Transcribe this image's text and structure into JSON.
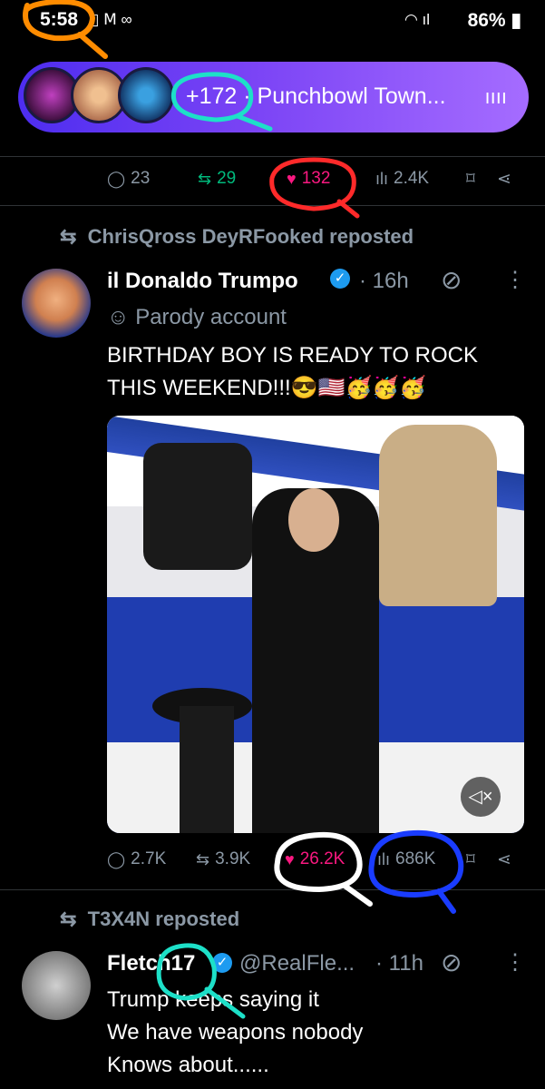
{
  "status_bar": {
    "time": "5:58",
    "battery": "86%"
  },
  "space": {
    "count": "+172 ·",
    "title": "Punchbowl Town..."
  },
  "prev_post": {
    "replies": "23",
    "reposts": "29",
    "likes": "132",
    "views": "2.4K"
  },
  "post1": {
    "reposted_by": "ChrisQross DeyRFooked reposted",
    "name": "il Donaldo Trumpo",
    "time": "· 16h",
    "parody": "Parody account",
    "text_line1": "BIRTHDAY BOY IS READY TO ROCK",
    "text_line2": "THIS WEEKEND!!!😎🇺🇸🥳🥳🥳",
    "replies": "2.7K",
    "reposts": "3.9K",
    "likes": "26.2K",
    "views": "686K"
  },
  "post2": {
    "reposted_by": "T3X4N reposted",
    "name": "Fletch17",
    "handle": "@RealFle...",
    "time": "· 11h",
    "text_line1": "Trump keeps saying it",
    "text_line2": "We have weapons nobody",
    "text_line3": "Knows about......"
  },
  "colors": {
    "like": "#f91880",
    "repost": "#00ba7c",
    "verified": "#1d9bf0",
    "pill_start": "#4d2df0",
    "pill_end": "#a56cff"
  }
}
